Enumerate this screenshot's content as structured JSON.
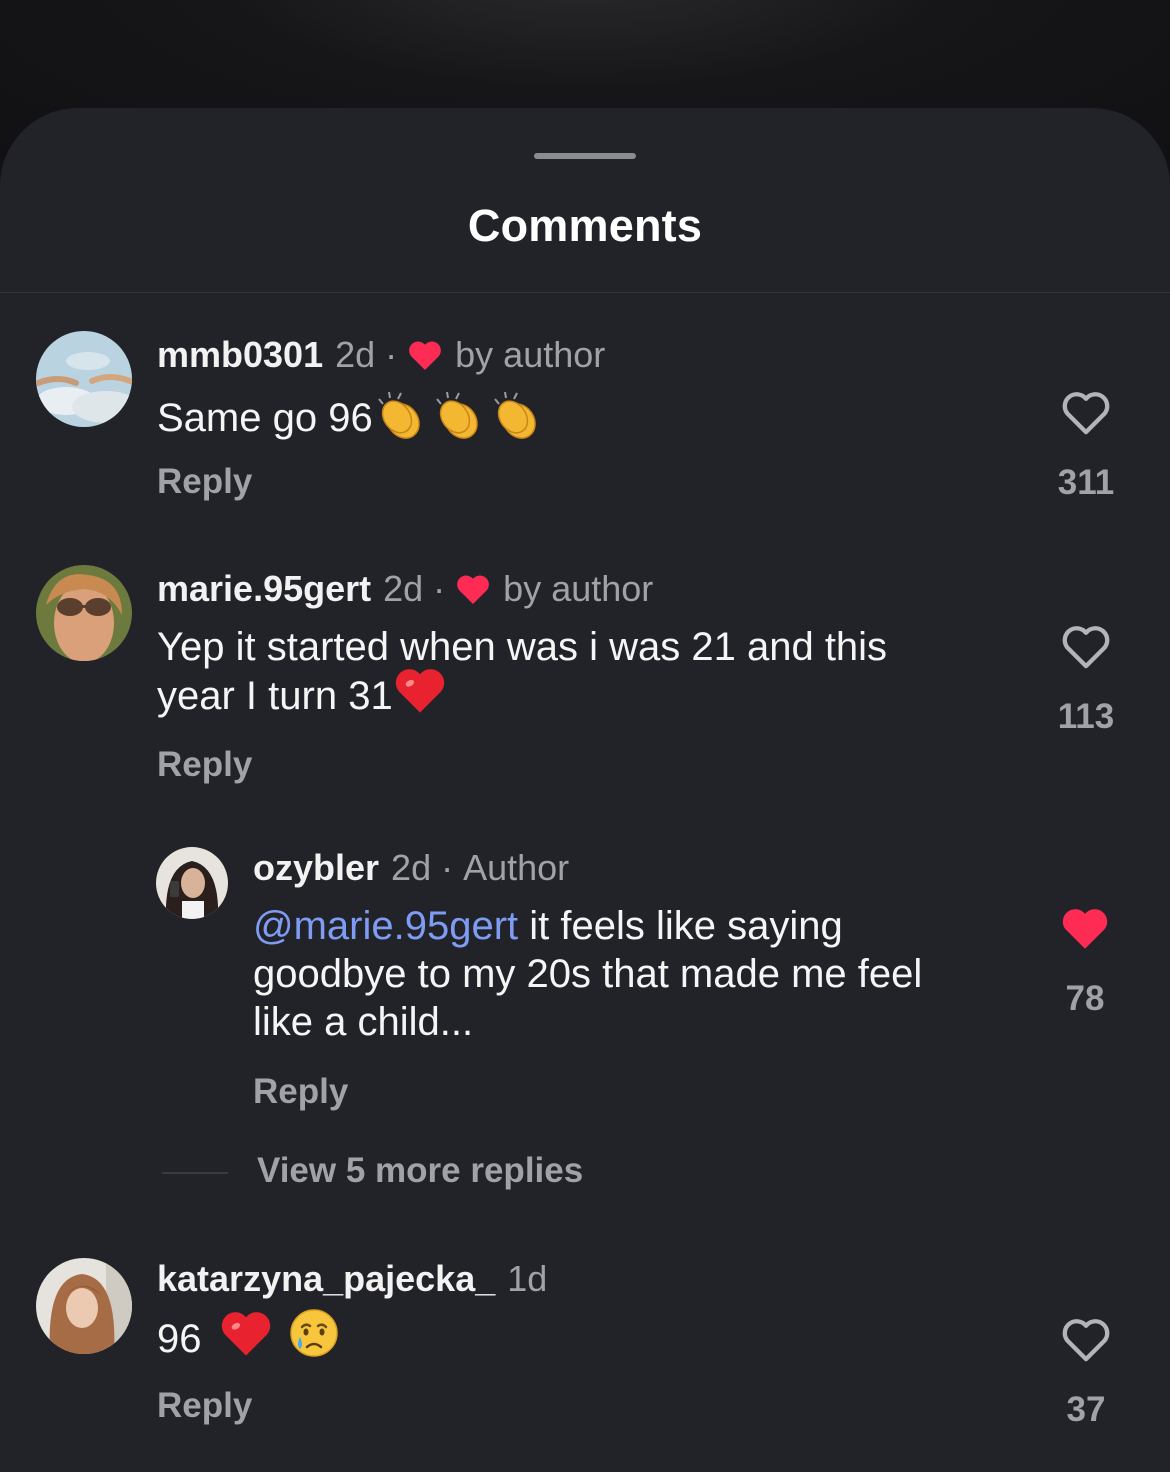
{
  "sheet": {
    "title": "Comments"
  },
  "comments": [
    {
      "username": "mmb0301",
      "time": "2d",
      "separator": "·",
      "author_like": "by author",
      "text": "Same go 96",
      "emojis": [
        "clapping-hands",
        "clapping-hands",
        "clapping-hands"
      ],
      "reply_label": "Reply",
      "like_count": "311",
      "liked": false
    },
    {
      "username": "marie.95gert",
      "time": "2d",
      "separator": "·",
      "author_like": "by author",
      "text_line1": "Yep it started when was i was 21 and this",
      "text_line2": "year I turn 31",
      "emojis": [
        "red-heart"
      ],
      "reply_label": "Reply",
      "like_count": "113",
      "liked": false
    }
  ],
  "reply": {
    "username": "ozybler",
    "time": "2d",
    "separator": "·",
    "badge": "Author",
    "mention": "@marie.95gert",
    "text_line1": " it feels like saying",
    "text_line2": "goodbye to my 20s that made me feel",
    "text_line3": "like a child...",
    "reply_label": "Reply",
    "like_count": "78",
    "liked": true
  },
  "view_more": "View 5 more replies",
  "comment3": {
    "username": "katarzyna_pajecka_",
    "time": "1d",
    "text": "96",
    "emojis": [
      "red-heart",
      "crying-face"
    ],
    "reply_label": "Reply",
    "like_count": "37",
    "liked": false
  },
  "colors": {
    "sheet_bg": "#222329",
    "muted_text": "#a1a2a8",
    "mention": "#7f9cf5",
    "like_red": "#fe2c55"
  }
}
